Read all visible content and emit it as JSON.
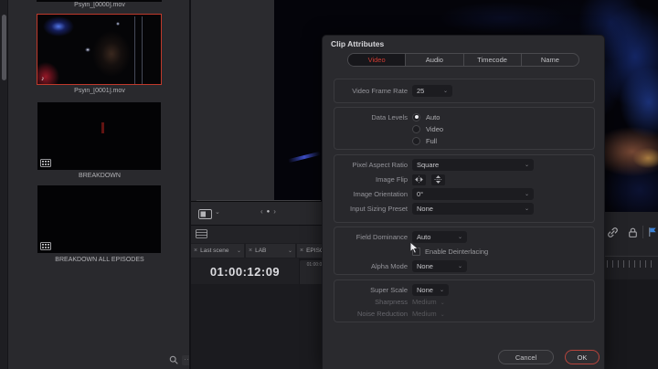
{
  "icons": {
    "chevron_down": "⌄",
    "close": "×",
    "prev": "‹",
    "next": "›",
    "dot": "●",
    "music_note": "♪",
    "ellipsis": "···"
  },
  "colors": {
    "accent_red": "#cf3b32",
    "ok_border": "#b5443c",
    "selection_border": "#c0392b",
    "flag_blue": "#3b82d6"
  },
  "media_pool": {
    "clips": [
      {
        "name": "Psyin_[0000].mov",
        "selected": false
      },
      {
        "name": "Psyin_[0001].mov",
        "selected": true,
        "badge": "audio"
      },
      {
        "name": "BREAKDOWN",
        "selected": false,
        "badge": "film"
      },
      {
        "name": "BREAKDOWN ALL EPISODES",
        "selected": false,
        "badge": "film"
      }
    ]
  },
  "timeline": {
    "tabs": [
      {
        "label": "Last scene"
      },
      {
        "label": "LAB"
      },
      {
        "label": "EPISO"
      }
    ],
    "timecode": "01:00:12:09",
    "timecode_small": "01:00:0"
  },
  "dialog": {
    "title": "Clip Attributes",
    "tabs": [
      {
        "label": "Video",
        "active": true
      },
      {
        "label": "Audio",
        "active": false
      },
      {
        "label": "Timecode",
        "active": false
      },
      {
        "label": "Name",
        "active": false
      }
    ],
    "video_frame_rate": {
      "label": "Video Frame Rate",
      "value": "25"
    },
    "data_levels": {
      "label": "Data Levels",
      "options": [
        "Auto",
        "Video",
        "Full"
      ],
      "selected": "Auto"
    },
    "pixel_aspect_ratio": {
      "label": "Pixel Aspect Ratio",
      "value": "Square"
    },
    "image_flip": {
      "label": "Image Flip"
    },
    "image_orientation": {
      "label": "Image Orientation",
      "value": "0°"
    },
    "input_sizing_preset": {
      "label": "Input Sizing Preset",
      "value": "None"
    },
    "field_dominance": {
      "label": "Field Dominance",
      "value": "Auto"
    },
    "enable_deinterlacing": {
      "label": "Enable Deinterlacing",
      "checked": false
    },
    "alpha_mode": {
      "label": "Alpha Mode",
      "value": "None"
    },
    "super_scale": {
      "label": "Super Scale",
      "value": "None"
    },
    "sharpness": {
      "label": "Sharpness",
      "value": "Medium",
      "disabled": true
    },
    "noise_reduction": {
      "label": "Noise Reduction",
      "value": "Medium",
      "disabled": true
    },
    "buttons": {
      "cancel": "Cancel",
      "ok": "OK"
    }
  }
}
